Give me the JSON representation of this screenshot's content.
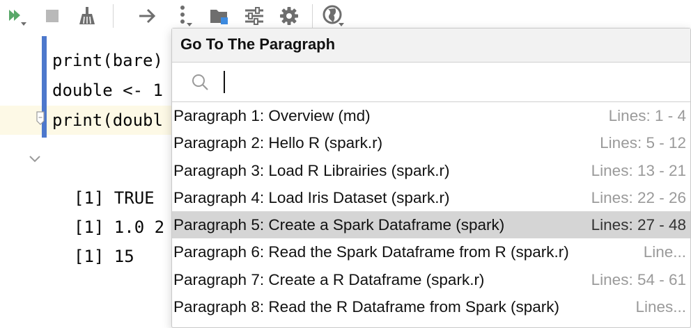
{
  "popup": {
    "title": "Go To The Paragraph",
    "search": {
      "value": "",
      "placeholder": ""
    },
    "items": [
      {
        "name": "Paragraph 1: Overview (md)",
        "lines": "Lines: 1 - 4"
      },
      {
        "name": "Paragraph 2: Hello R (spark.r)",
        "lines": "Lines: 5 - 12"
      },
      {
        "name": "Paragraph 3: Load R Librairies (spark.r)",
        "lines": "Lines: 13 - 21"
      },
      {
        "name": "Paragraph 4: Load Iris Dataset (spark.r)",
        "lines": "Lines: 22 - 26"
      },
      {
        "name": "Paragraph 5: Create a Spark Dataframe (spark)",
        "lines": "Lines: 27 - 48"
      },
      {
        "name": "Paragraph 6: Read the Spark Dataframe from R (spark.r)",
        "lines": "Line..."
      },
      {
        "name": "Paragraph 7: Create a R Dataframe (spark.r)",
        "lines": "Lines: 54 - 61"
      },
      {
        "name": "Paragraph 8: Read the R Dataframe from Spark (spark)",
        "lines": "Lines..."
      }
    ],
    "selected_index": 4
  },
  "editor": {
    "code_lines": [
      "print(bare)",
      "double <- 1",
      "print(doubl"
    ],
    "output_lines": [
      "[1] TRUE",
      "[1] 1.0 2",
      "[1] 15"
    ]
  },
  "colors": {
    "run_green": "#59a869",
    "accent_blue": "#4d78cc",
    "selection_gray": "#d5d5d5",
    "icon_gray": "#6e6e6e"
  }
}
